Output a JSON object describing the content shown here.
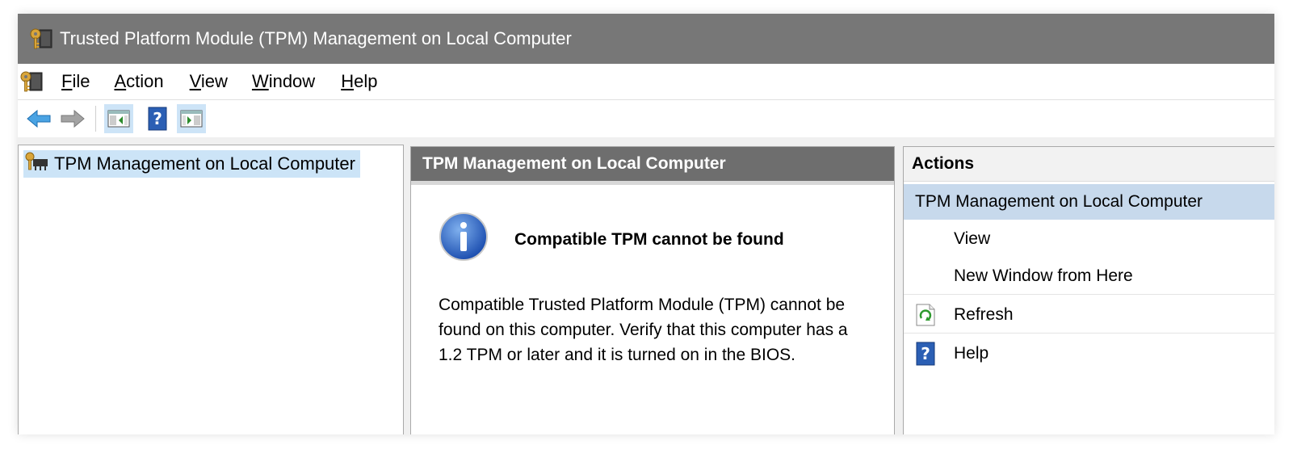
{
  "window": {
    "title": "Trusted Platform Module (TPM) Management on Local Computer"
  },
  "menu": {
    "items": [
      {
        "label": "File",
        "accel": "F",
        "rest": "ile"
      },
      {
        "label": "Action",
        "accel": "A",
        "rest": "ction"
      },
      {
        "label": "View",
        "accel": "V",
        "rest": "iew"
      },
      {
        "label": "Window",
        "accel": "W",
        "rest": "indow"
      },
      {
        "label": "Help",
        "accel": "H",
        "rest": "elp"
      }
    ]
  },
  "toolbar": {
    "icons": [
      "back-arrow-icon",
      "forward-arrow-icon",
      "show-hide-console-tree-icon",
      "help-icon",
      "show-hide-action-pane-icon"
    ]
  },
  "tree": {
    "root_label": "TPM Management on Local Computer"
  },
  "center": {
    "header": "TPM Management on Local Computer",
    "info_title": "Compatible TPM cannot be found",
    "info_body": "Compatible Trusted Platform Module (TPM) cannot be found on this computer. Verify that this computer has a 1.2 TPM or later and it is turned on in the BIOS."
  },
  "actions": {
    "header": "Actions",
    "section": "TPM Management on Local Computer",
    "items": [
      {
        "label": "View",
        "icon": ""
      },
      {
        "label": "New Window from Here",
        "icon": ""
      },
      {
        "label": "Refresh",
        "icon": "refresh-icon"
      },
      {
        "label": "Help",
        "icon": "help-icon"
      }
    ]
  },
  "colors": {
    "title_bar": "#777777",
    "selection": "#cce4f7",
    "actions_section": "#c7d9ec"
  }
}
